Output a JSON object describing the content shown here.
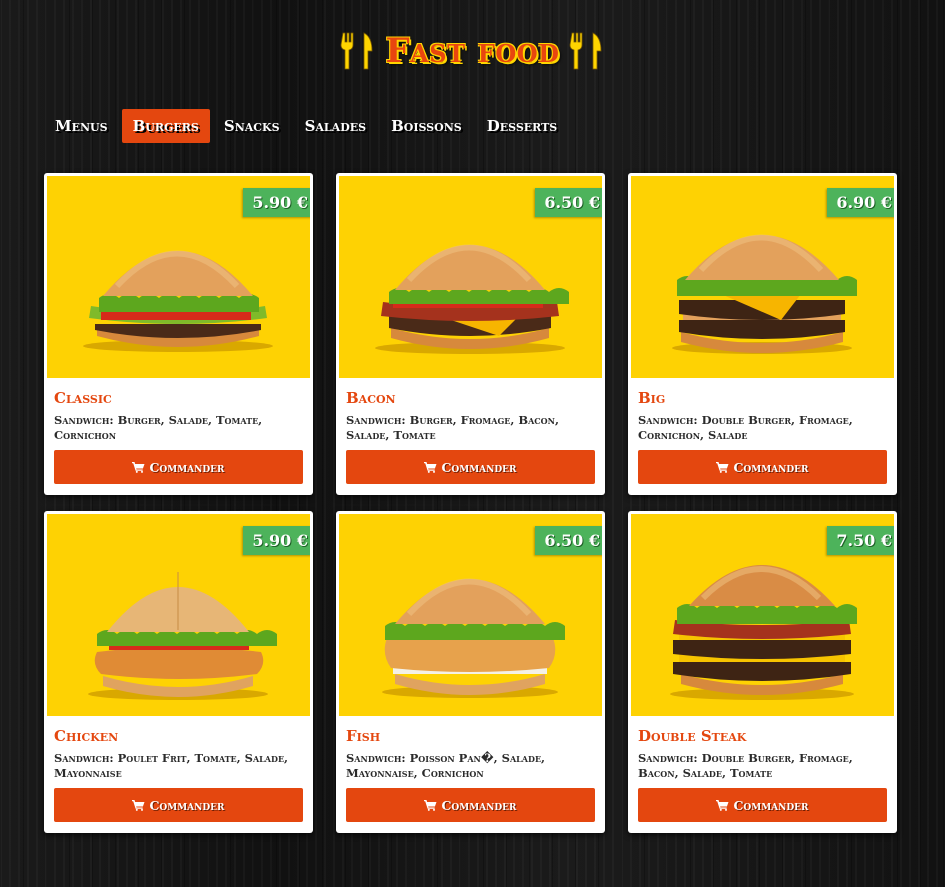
{
  "header": {
    "title": "Fast food"
  },
  "nav": {
    "items": [
      {
        "label": "Menus"
      },
      {
        "label": "Burgers"
      },
      {
        "label": "Snacks"
      },
      {
        "label": "Salades"
      },
      {
        "label": "Boissons"
      },
      {
        "label": "Desserts"
      }
    ],
    "active_index": 1
  },
  "colors": {
    "accent": "#e4470f",
    "price_badge": "#4db35b",
    "image_background": "#fed203",
    "title_outline": "#ffd500"
  },
  "icons": [
    "cutlery-icon",
    "cart-icon"
  ],
  "products": [
    {
      "name": "Classic",
      "price": "5.90 €",
      "description": "Sandwich: Burger, Salade, Tomate, Cornichon",
      "button": "Commander",
      "image": "classic-burger-image"
    },
    {
      "name": "Bacon",
      "price": "6.50 €",
      "description": "Sandwich: Burger, Fromage, Bacon, Salade, Tomate",
      "button": "Commander",
      "image": "bacon-burger-image"
    },
    {
      "name": "Big",
      "price": "6.90 €",
      "description": "Sandwich: Double Burger, Fromage, Cornichon, Salade",
      "button": "Commander",
      "image": "big-burger-image"
    },
    {
      "name": "Chicken",
      "price": "5.90 €",
      "description": "Sandwich: Poulet Frit, Tomate, Salade, Mayonnaise",
      "button": "Commander",
      "image": "chicken-burger-image"
    },
    {
      "name": "Fish",
      "price": "6.50 €",
      "description": "Sandwich: Poisson Pan�, Salade, Mayonnaise, Cornichon",
      "button": "Commander",
      "image": "fish-burger-image"
    },
    {
      "name": "Double Steak",
      "price": "7.50 €",
      "description": "Sandwich: Double Burger, Fromage, Bacon, Salade, Tomate",
      "button": "Commander",
      "image": "double-steak-burger-image"
    }
  ]
}
